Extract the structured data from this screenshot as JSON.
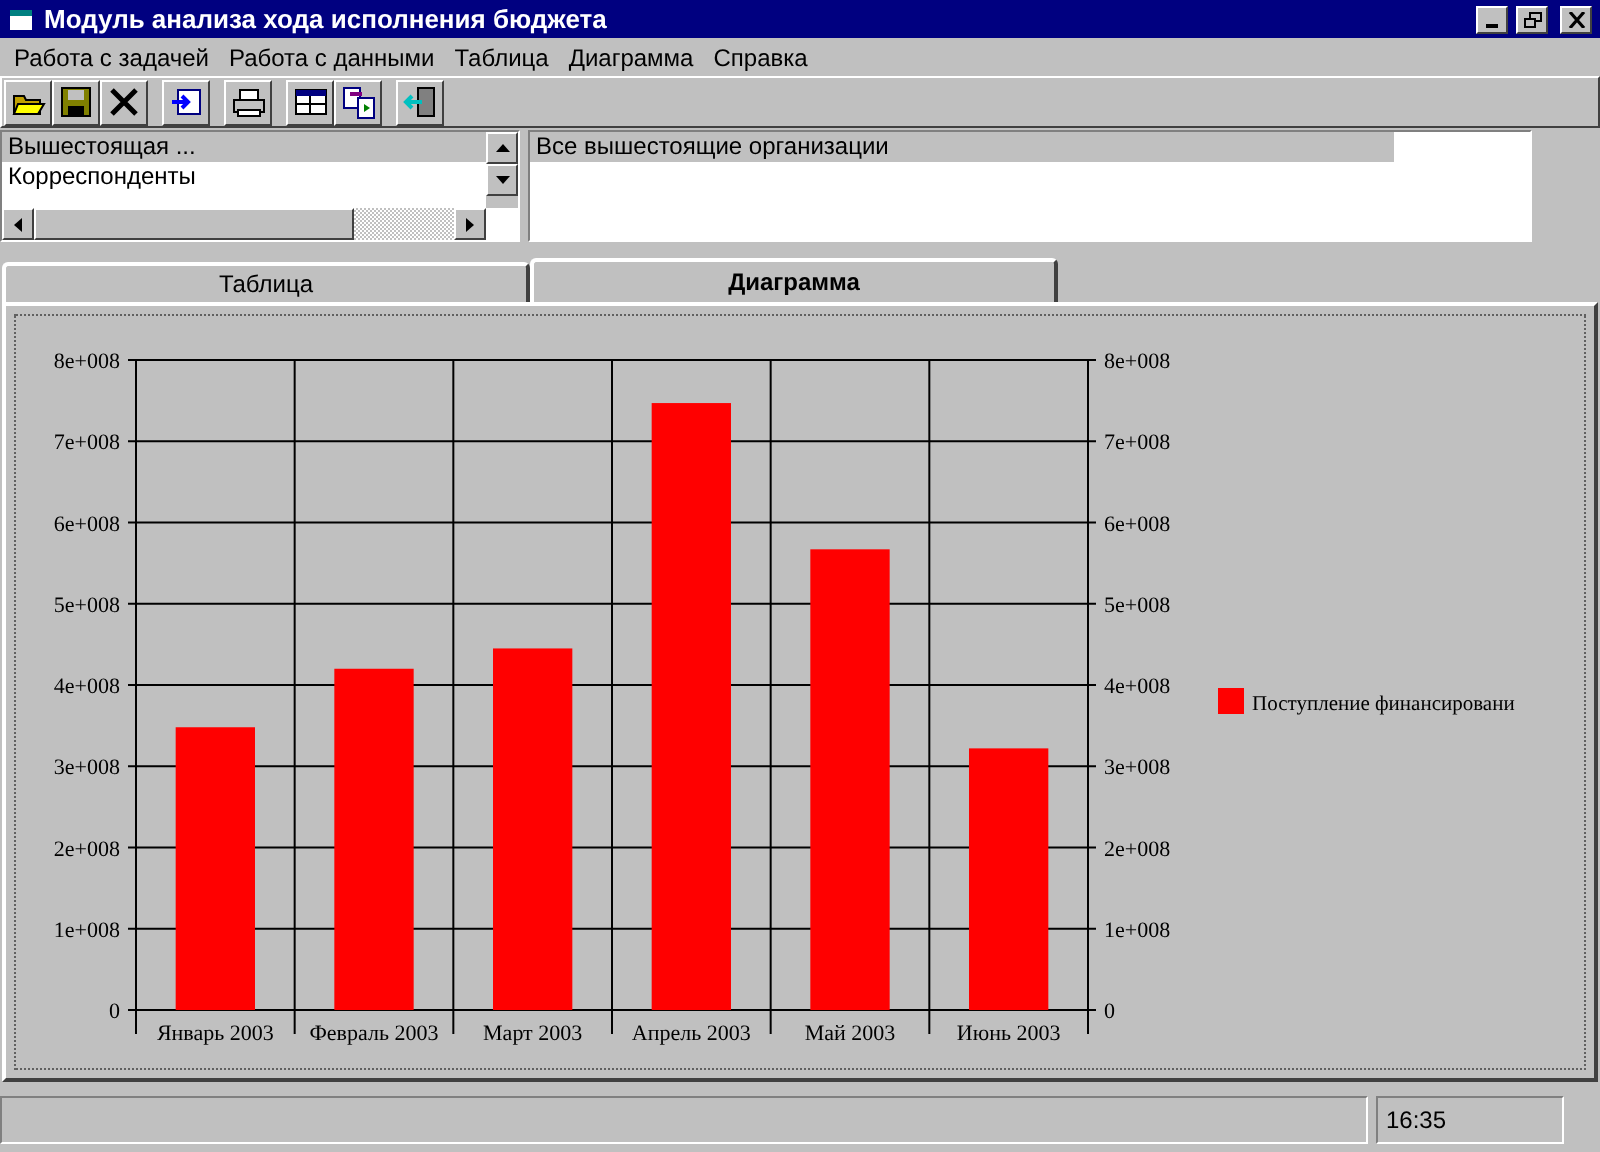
{
  "window": {
    "title": "Модуль анализа хода исполнения бюджета"
  },
  "menu": [
    "Работа с задачей",
    "Работа с данными",
    "Таблица",
    "Диаграмма",
    "Справка"
  ],
  "toolbar": [
    {
      "kind": "open"
    },
    {
      "kind": "save"
    },
    {
      "kind": "delete"
    },
    {
      "kind": "import"
    },
    {
      "kind": "print"
    },
    {
      "kind": "table"
    },
    {
      "kind": "transfer"
    },
    {
      "kind": "exit"
    }
  ],
  "left_list": {
    "items": [
      {
        "label": "Вышестоящая ...",
        "selected": true
      },
      {
        "label": "Корреспонденты",
        "selected": false
      }
    ]
  },
  "right_list": {
    "items": [
      {
        "label": "Все вышестоящие организации",
        "selected": true
      }
    ]
  },
  "tabs": [
    {
      "label": "Таблица",
      "selected": false
    },
    {
      "label": "Диаграмма",
      "selected": true
    }
  ],
  "chart": {
    "chart_data": {
      "type": "bar",
      "categories": [
        "Январь 2003",
        "Февраль 2003",
        "Март 2003",
        "Апрель 2003",
        "Май 2003",
        "Июнь 2003"
      ],
      "series": [
        {
          "name": "Поступление финансировани",
          "color": "#ff0000",
          "values": [
            348000000,
            420000000,
            445000000,
            747000000,
            567000000,
            322000000
          ]
        }
      ],
      "ylim": [
        0,
        800000000
      ],
      "grid": true,
      "yticks": [
        {
          "value": 0,
          "label": "0"
        },
        {
          "value": 100000000,
          "label": "1e+008"
        },
        {
          "value": 200000000,
          "label": "2e+008"
        },
        {
          "value": 300000000,
          "label": "3e+008"
        },
        {
          "value": 400000000,
          "label": "4e+008"
        },
        {
          "value": 500000000,
          "label": "5e+008"
        },
        {
          "value": 600000000,
          "label": "6e+008"
        },
        {
          "value": 700000000,
          "label": "7e+008"
        },
        {
          "value": 800000000,
          "label": "8e+008"
        }
      ]
    }
  },
  "status_bar": {
    "time": "16:35"
  }
}
